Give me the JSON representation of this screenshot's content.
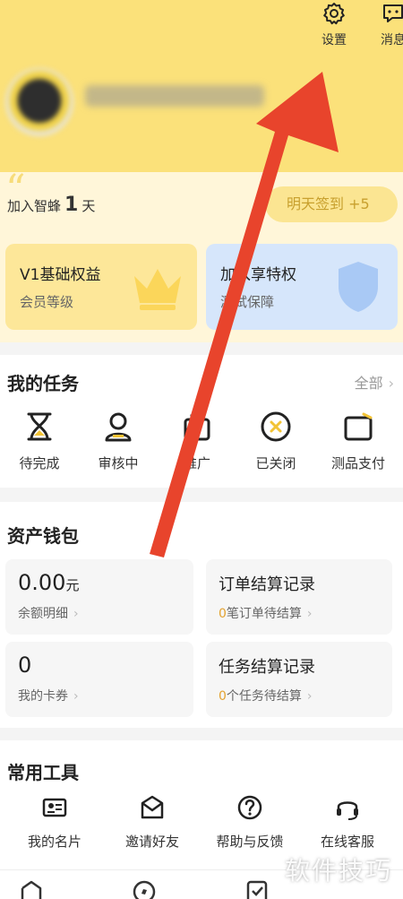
{
  "header": {
    "settings_label": "设置",
    "messages_label": "消息",
    "settings_icon": "gear-icon",
    "messages_icon": "chat-icon"
  },
  "member": {
    "join_prefix": "加入智蜂",
    "join_days": "1",
    "join_suffix": "天",
    "checkin_label": "明天签到 +5"
  },
  "cards": [
    {
      "title": "V1基础权益",
      "subtitle": "会员等级",
      "icon": "crown-icon"
    },
    {
      "title": "加入享特权",
      "subtitle": "测试保障",
      "icon": "shield-icon"
    }
  ],
  "tasks": {
    "title": "我的任务",
    "more": "全部",
    "items": [
      {
        "label": "待完成",
        "icon": "hourglass-icon"
      },
      {
        "label": "审核中",
        "icon": "reviewer-icon"
      },
      {
        "label": "推广",
        "icon": "bag-icon"
      },
      {
        "label": "已关闭",
        "icon": "closed-circle-icon"
      },
      {
        "label": "测品支付",
        "icon": "wallet-icon"
      }
    ]
  },
  "wallet": {
    "title": "资产钱包",
    "balance": "0.00",
    "balance_unit": "元",
    "balance_detail": "余额明细",
    "coupons": "0",
    "coupons_label": "我的卡券",
    "order_title": "订单结算记录",
    "order_count": "0",
    "order_sub": "笔订单待结算",
    "task_title": "任务结算记录",
    "task_count": "0",
    "task_sub": "个任务待结算"
  },
  "tools": {
    "title": "常用工具",
    "items": [
      {
        "label": "我的名片",
        "icon": "id-card-icon"
      },
      {
        "label": "邀请好友",
        "icon": "invite-icon"
      },
      {
        "label": "帮助与反馈",
        "icon": "help-icon"
      },
      {
        "label": "在线客服",
        "icon": "headset-icon"
      }
    ]
  },
  "watermark": "软件技巧",
  "colors": {
    "accent": "#fbe17a",
    "arrow": "#e8442c",
    "highlight": "#e3a230"
  }
}
